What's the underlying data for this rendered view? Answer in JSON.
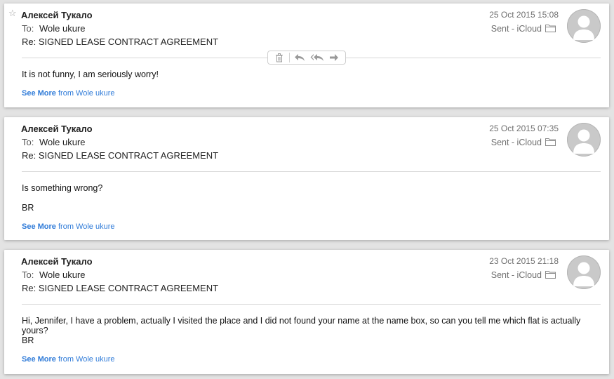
{
  "messages": [
    {
      "sender": "Алексей Тукало",
      "to_label": "To:",
      "to": "Wole ukure",
      "subject": "Re: SIGNED LEASE CONTRACT AGREEMENT",
      "date": "25 Oct 2015 15:08",
      "mailbox": "Sent - iCloud",
      "body": [
        "It is not funny, I am seriously worry!"
      ],
      "see_more_bold": "See More",
      "see_more_rest": " from Wole ukure",
      "starred": false
    },
    {
      "sender": "Алексей Тукало",
      "to_label": "To:",
      "to": "Wole ukure",
      "subject": "Re: SIGNED LEASE CONTRACT AGREEMENT",
      "date": "25 Oct 2015 07:35",
      "mailbox": "Sent - iCloud",
      "body": [
        "Is something wrong?",
        "BR"
      ],
      "see_more_bold": "See More",
      "see_more_rest": " from Wole ukure"
    },
    {
      "sender": "Алексей Тукало",
      "to_label": "To:",
      "to": "Wole ukure",
      "subject": "Re: SIGNED LEASE CONTRACT AGREEMENT",
      "date": "23 Oct 2015 21:18",
      "mailbox": "Sent - iCloud",
      "body": [
        "Hi, Jennifer, I have a problem, actually I visited the place and I did not found your name at the name box, so can you tell me which flat is actually yours?",
        "BR"
      ],
      "see_more_bold": "See More",
      "see_more_rest": " from Wole ukure"
    }
  ],
  "toolbar": {
    "icons": [
      "trash-icon",
      "reply-icon",
      "reply-all-icon",
      "forward-icon"
    ]
  },
  "icons": {
    "star": "☆"
  },
  "colors": {
    "link": "#2f7bd8",
    "meta_text": "#6f6f6f",
    "avatar_bg": "#c9c9c9"
  }
}
